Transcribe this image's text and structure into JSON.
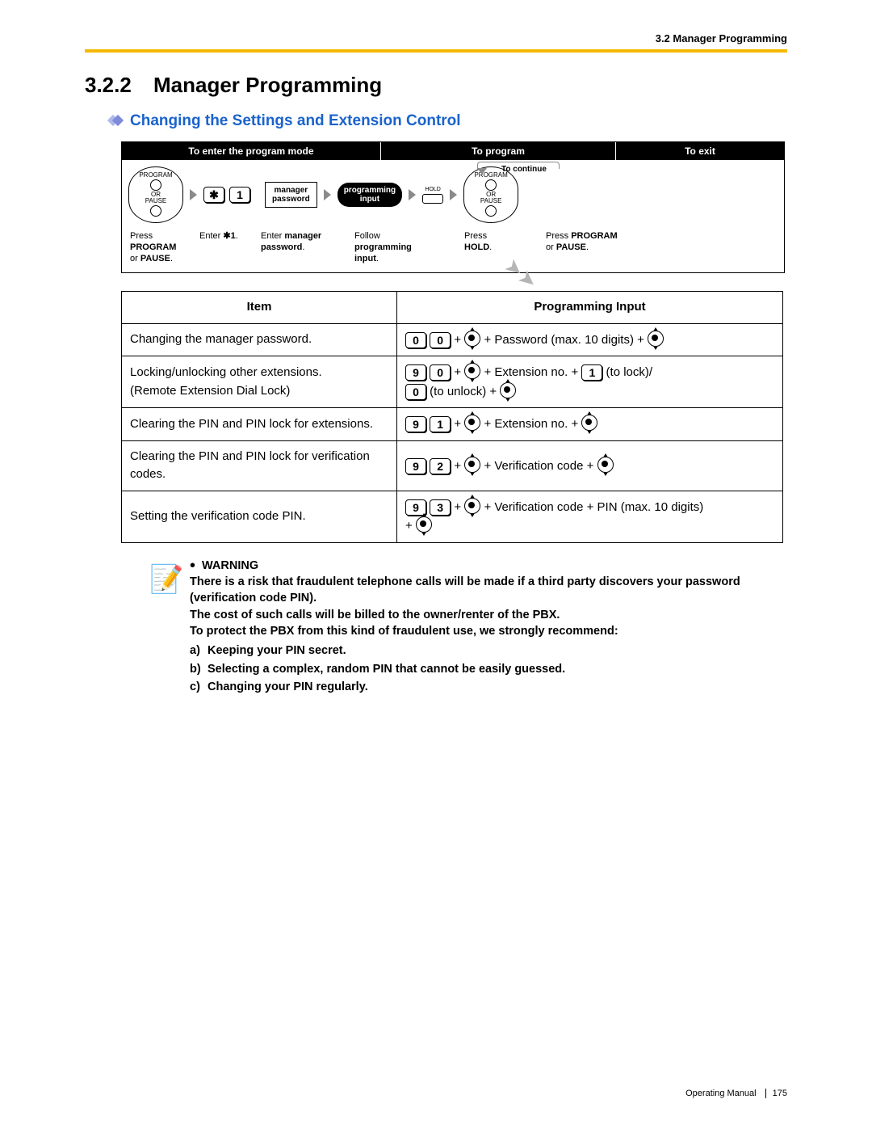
{
  "header": {
    "running": "3.2 Manager Programming"
  },
  "title": {
    "number": "3.2.2",
    "text": "Manager Programming"
  },
  "subtitle": "Changing the Settings and Extension Control",
  "flow": {
    "h1": "To enter the program mode",
    "h2": "To program",
    "h3": "To exit",
    "continue": "To continue",
    "phone_top": "PROGRAM",
    "phone_mid": "OR",
    "phone_bot": "PAUSE",
    "star": "✱",
    "one": "1",
    "mgr_pw1": "manager",
    "mgr_pw2": "password",
    "pill1": "programming",
    "pill2": "input",
    "hold": "HOLD",
    "cap1a": "Press ",
    "cap1b": "PROGRAM",
    "cap1c": "or ",
    "cap1d": "PAUSE",
    "cap1e": ".",
    "cap2a": "Enter ",
    "cap2b": "✱1",
    "cap2c": ".",
    "cap3a": "Enter ",
    "cap3b": "manager",
    "cap3c": "password",
    "cap3d": ".",
    "cap4a": "Follow",
    "cap4b": "programming",
    "cap4c": "input",
    "cap4d": ".",
    "cap5a": "Press",
    "cap5b": "HOLD",
    "cap5c": ".",
    "cap6a": "Press ",
    "cap6b": "PROGRAM",
    "cap6c": "or ",
    "cap6d": "PAUSE",
    "cap6e": "."
  },
  "table": {
    "th1": "Item",
    "th2": "Programming Input",
    "r1_item": "Changing the manager password.",
    "r1_a": "0",
    "r1_b": "0",
    "r1_txt1": " + ",
    "r1_txt2": " + Password (max. 10 digits) + ",
    "r2_item1": "Locking/unlocking other extensions.",
    "r2_item2": "(Remote Extension Dial Lock)",
    "r2_a": "9",
    "r2_b": "0",
    "r2_txt1": " + ",
    "r2_txt2": " + Extension no. + ",
    "r2_c": "1",
    "r2_txt3": " (to lock)/",
    "r2_d": "0",
    "r2_txt4": " (to unlock) + ",
    "r3_item": "Clearing the PIN and PIN lock for extensions.",
    "r3_a": "9",
    "r3_b": "1",
    "r3_txt1": " + ",
    "r3_txt2": " + Extension no. + ",
    "r4_item": "Clearing the PIN and PIN lock for verification codes.",
    "r4_a": "9",
    "r4_b": "2",
    "r4_txt1": " + ",
    "r4_txt2": " + Verification code + ",
    "r5_item": "Setting the verification code PIN.",
    "r5_a": "9",
    "r5_b": "3",
    "r5_txt1": " + ",
    "r5_txt2": " + Verification code + PIN (max. 10 digits)",
    "r5_txt3": "+ "
  },
  "warning": {
    "title": "WARNING",
    "p1": "There is a risk that fraudulent telephone calls will be made if a third party discovers your password (verification code PIN).",
    "p2": "The cost of such calls will be billed to the owner/renter of the PBX.",
    "p3": "To protect the PBX from this kind of fraudulent use, we strongly recommend:",
    "a_m": "a)",
    "a": "Keeping your PIN secret.",
    "b_m": "b)",
    "b": "Selecting a complex, random PIN that cannot be easily guessed.",
    "c_m": "c)",
    "c": "Changing your PIN regularly."
  },
  "footer": {
    "book": "Operating Manual",
    "page": "175"
  }
}
